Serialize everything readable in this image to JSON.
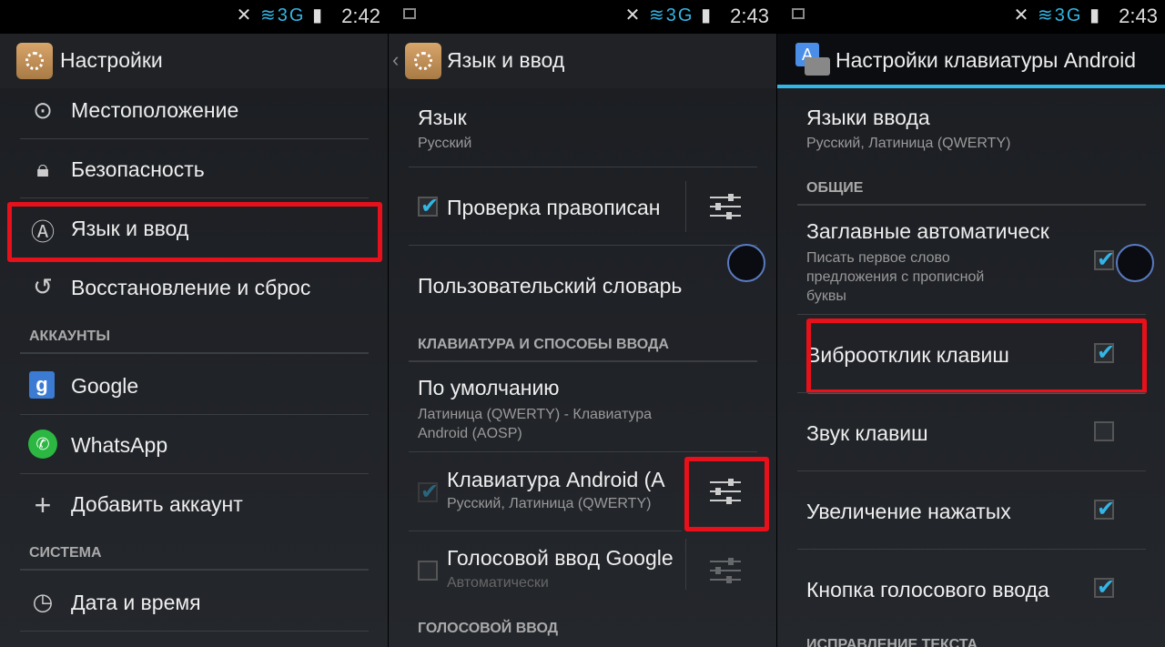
{
  "panels": [
    {
      "status": {
        "time": "2:42",
        "network": "3G"
      },
      "title": "Настройки",
      "items": [
        "Местоположение",
        "Безопасность",
        "Язык и ввод",
        "Восстановление и сброс"
      ],
      "accounts_header": "АККАУНТЫ",
      "accounts": [
        "Google",
        "WhatsApp",
        "Добавить аккаунт"
      ],
      "system_header": "СИСТЕМА",
      "system": [
        "Дата и время"
      ],
      "highlighted": "Язык и ввод"
    },
    {
      "status": {
        "time": "2:43",
        "network": "3G"
      },
      "title": "Язык и ввод",
      "language": {
        "label": "Язык",
        "value": "Русский"
      },
      "spellcheck": {
        "label": "Проверка правописан",
        "checked": true
      },
      "user_dict": "Пользовательский словарь",
      "kb_header": "КЛАВИАТУРА И СПОСОБЫ ВВОДА",
      "default": {
        "label": "По умолчанию",
        "value1": "Латиница (QWERTY) - Клавиатура",
        "value2": "Android (AOSP)"
      },
      "android_kb": {
        "label": "Клавиатура Android (A",
        "value": "Русский, Латиница (QWERTY)",
        "checked": true
      },
      "voice": {
        "label": "Голосовой ввод Google",
        "value": "Автоматически",
        "checked": false
      },
      "voice_header": "ГОЛОСОВОЙ ВВОД",
      "highlighted": "android-keyboard-settings"
    },
    {
      "status": {
        "time": "2:43",
        "network": "3G"
      },
      "title": "Настройки клавиатуры Android",
      "input_langs": {
        "label": "Языки ввода",
        "value": "Русский, Латиница (QWERTY)"
      },
      "general_header": "ОБЩИЕ",
      "autocaps": {
        "label": "Заглавные автоматическ",
        "d1": "Писать первое слово",
        "d2": "предложения с прописной",
        "d3": "буквы",
        "checked": true
      },
      "vibrate": {
        "label": "Виброотклик клавиш",
        "checked": true
      },
      "sound": {
        "label": "Звук клавиш",
        "checked": false
      },
      "popup": {
        "label": "Увеличение нажатых",
        "checked": true
      },
      "voice_key": {
        "label": "Кнопка голосового ввода",
        "checked": true
      },
      "correction_header": "ИСПРАВЛЕНИЕ ТЕКСТА",
      "highlighted": "Виброотклик клавиш"
    }
  ],
  "colors": {
    "accent": "#33b5e5",
    "highlight": "#e8101a"
  }
}
